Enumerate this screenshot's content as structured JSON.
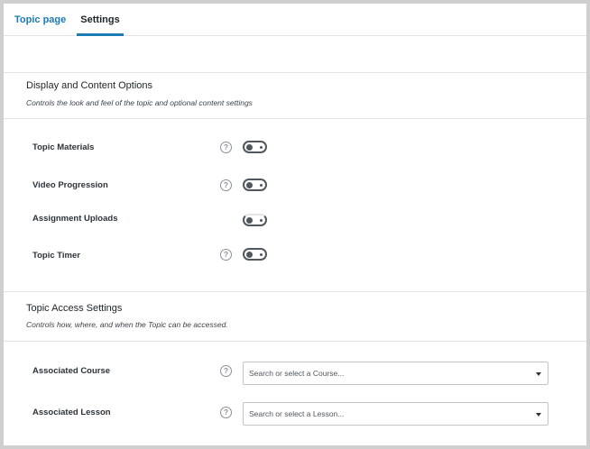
{
  "tabs": [
    {
      "label": "Topic page",
      "active": false
    },
    {
      "label": "Settings",
      "active": true
    }
  ],
  "display": {
    "title": "Display and Content Options",
    "description": "Controls the look and feel of the topic and optional content settings",
    "rows": [
      {
        "label": "Topic Materials",
        "help": "?",
        "enabled": false
      },
      {
        "label": "Video Progression",
        "help": "?",
        "enabled": false
      },
      {
        "label": "Assignment Uploads",
        "help": "",
        "enabled": false
      },
      {
        "label": "Topic Timer",
        "help": "?",
        "enabled": false
      }
    ]
  },
  "access": {
    "title": "Topic Access Settings",
    "description": "Controls how, where, and when the Topic can be accessed.",
    "rows": [
      {
        "label": "Associated Course",
        "help": "?",
        "placeholder": "Search or select a Course..."
      },
      {
        "label": "Associated Lesson",
        "help": "?",
        "placeholder": "Search or select a Lesson..."
      }
    ]
  },
  "colors": {
    "accent": "#1c7bb5",
    "toggle": "#50575e",
    "border": "#e2e4e7"
  },
  "icons": {
    "help": "question-circle-icon",
    "toggle_knob": "toggle-knob-icon",
    "select_caret": "caret-down-icon"
  }
}
